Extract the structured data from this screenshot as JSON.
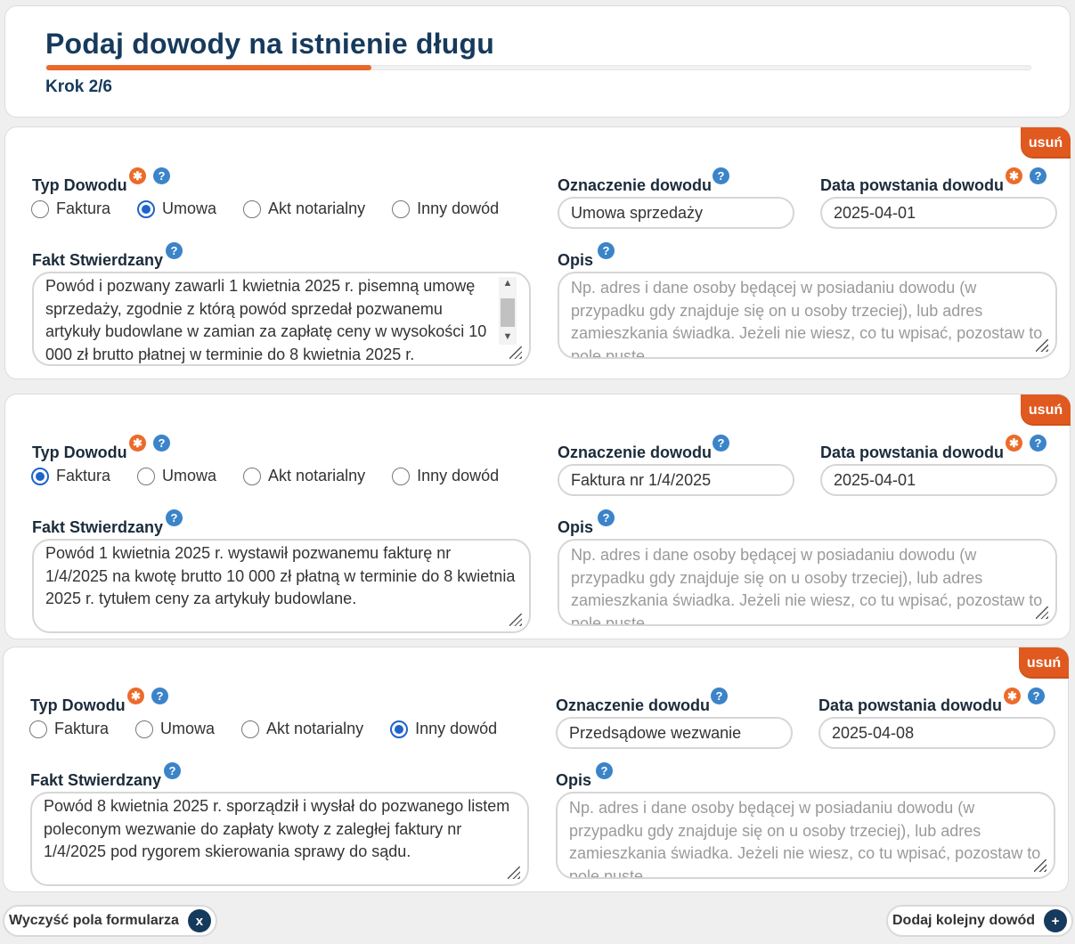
{
  "header": {
    "title": "Podaj dowody na istnienie długu",
    "step_label": "Krok 2/6",
    "progress": 0.33
  },
  "labels": {
    "type": "Typ Dowodu",
    "designation": "Oznaczenie dowodu",
    "date": "Data powstania dowodu",
    "fact": "Fakt Stwierdzany",
    "description": "Opis",
    "remove": "usuń",
    "required_symbol": "✱",
    "help_symbol": "?"
  },
  "type_options": [
    "Faktura",
    "Umowa",
    "Akt notarialny",
    "Inny dowód"
  ],
  "description_placeholder": "Np. adres i dane osoby będącej w posiadaniu dowodu (w przypadku gdy znajduje się on u osoby trzeciej), lub adres zamieszkania świadka. Jeżeli nie wiesz, co tu wpisać, pozostaw to pole puste.",
  "evidences": [
    {
      "selected_type": "Umowa",
      "designation": "Umowa sprzedaży",
      "date": "2025-04-01",
      "fact": "Powód i pozwany zawarli 1 kwietnia 2025 r. pisemną umowę sprzedaży, zgodnie z którą powód sprzedał pozwanemu artykuły budowlane w zamian za zapłatę ceny w wysokości 10 000 zł brutto płatnej w terminie do 8 kwietnia 2025 r.",
      "description": ""
    },
    {
      "selected_type": "Faktura",
      "designation": "Faktura nr 1/4/2025",
      "date": "2025-04-01",
      "fact": "Powód 1 kwietnia 2025 r. wystawił pozwanemu fakturę nr 1/4/2025 na kwotę brutto 10 000 zł płatną w terminie do 8 kwietnia 2025 r. tytułem ceny za artykuły budowlane.",
      "description": ""
    },
    {
      "selected_type": "Inny dowód",
      "designation": "Przedsądowe wezwanie",
      "date": "2025-04-08",
      "fact": "Powód 8 kwietnia 2025 r. sporządził i wysłał do pozwanego listem poleconym  wezwanie do zapłaty kwoty z zaległej faktury nr 1/4/2025 pod rygorem skierowania sprawy do sądu.",
      "description": ""
    }
  ],
  "footer": {
    "clear_label": "Wyczyść pola formularza",
    "clear_icon": "x",
    "add_label": "Dodaj kolejny dowód",
    "add_icon": "+"
  }
}
